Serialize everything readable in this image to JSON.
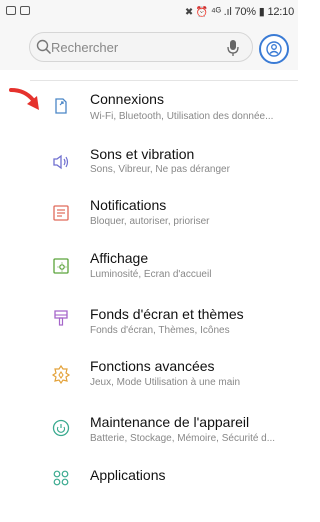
{
  "status_bar": {
    "indicators": "⁴ᴳ .ıl 70%",
    "time": "12:10"
  },
  "search": {
    "placeholder": "Rechercher"
  },
  "settings": [
    {
      "title": "Connexions",
      "subtitle": "Wi-Fi, Bluetooth, Utilisation des donnée...",
      "icon": "connections-icon"
    },
    {
      "title": "Sons et vibration",
      "subtitle": "Sons, Vibreur, Ne pas déranger",
      "icon": "sound-icon"
    },
    {
      "title": "Notifications",
      "subtitle": "Bloquer, autoriser, prioriser",
      "icon": "notifications-icon"
    },
    {
      "title": "Affichage",
      "subtitle": "Luminosité, Écran d'accueil",
      "icon": "display-icon"
    },
    {
      "title": "Fonds d'écran et thèmes",
      "subtitle": "Fonds d'écran, Thèmes, Icônes",
      "icon": "wallpaper-icon"
    },
    {
      "title": "Fonctions avancées",
      "subtitle": "Jeux, Mode Utilisation à une main",
      "icon": "advanced-features-icon"
    },
    {
      "title": "Maintenance de l'appareil",
      "subtitle": "Batterie, Stockage, Mémoire, Sécurité d...",
      "icon": "device-maintenance-icon"
    },
    {
      "title": "Applications",
      "subtitle": "",
      "icon": "applications-icon"
    }
  ],
  "colors": {
    "accent": "#3a7bd5",
    "annotation_arrow": "#e5322d"
  }
}
